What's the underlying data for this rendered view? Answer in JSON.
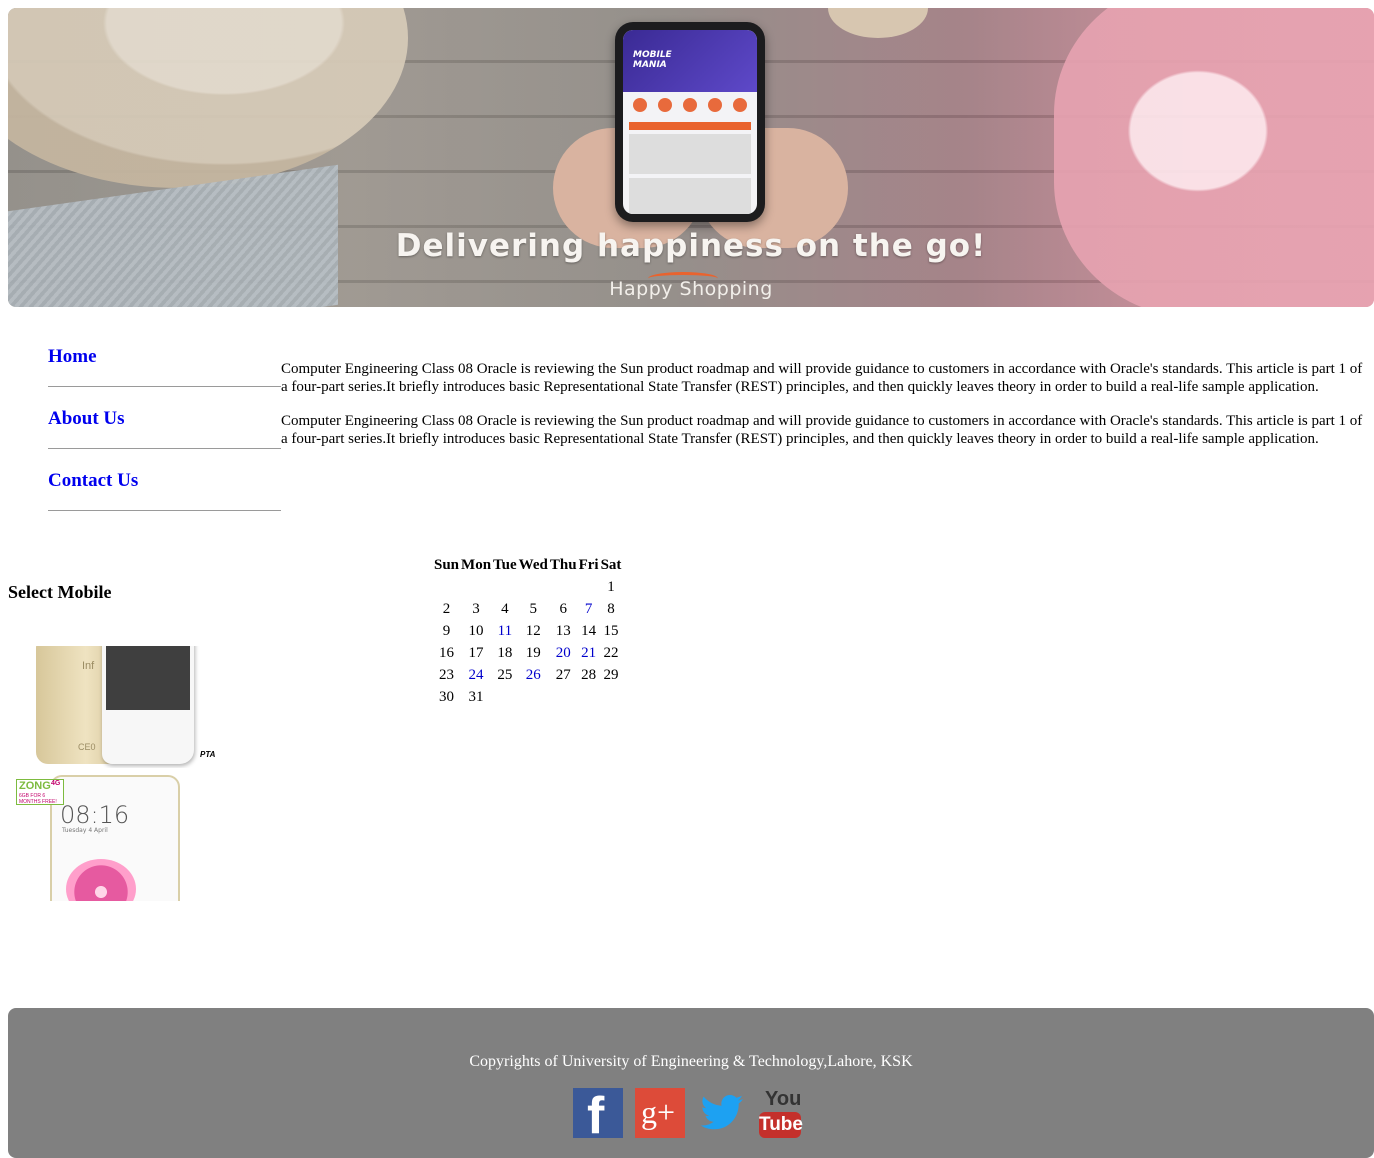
{
  "banner": {
    "headline": "Delivering happiness on the go!",
    "subline": "Happy Shopping",
    "phone_screen_title": "MOBILE MANIA"
  },
  "nav": {
    "items": [
      {
        "label": "Home"
      },
      {
        "label": "About Us"
      },
      {
        "label": "Contact Us"
      }
    ],
    "link_color": "#0000ee"
  },
  "article": {
    "paragraphs": [
      "Computer Engineering Class 08 Oracle is reviewing the Sun product roadmap and will provide guidance to customers in accordance with Oracle's standards. This article is part 1 of a four-part series.It briefly introduces basic Representational State Transfer (REST) principles, and then quickly leaves theory in order to build a real-life sample application.",
      "Computer Engineering Class 08 Oracle is reviewing the Sun product roadmap and will provide guidance to customers in accordance with Oracle's standards. This article is part 1 of a four-part series.It briefly introduces basic Representational State Transfer (REST) principles, and then quickly leaves theory in order to build a real-life sample application."
    ]
  },
  "select_mobile": {
    "heading": "Select Mobile",
    "mobiles": [
      {
        "brand_text": "Inf",
        "cert_text": "CE0",
        "badge": "PTA"
      },
      {
        "carrier_text": "ZONG",
        "carrier_badge": "4G",
        "offer_text": "6GB FOR 6 MONTHS FREE!",
        "lock_time": "08:16",
        "lock_date": "Tuesday 4 April"
      }
    ]
  },
  "calendar": {
    "weekdays": [
      "Sun",
      "Mon",
      "Tue",
      "Wed",
      "Thu",
      "Fri",
      "Sat"
    ],
    "weeks": [
      [
        "",
        "",
        "",
        "",
        "",
        "",
        "1"
      ],
      [
        "2",
        "3",
        "4",
        "5",
        "6",
        "7",
        "8"
      ],
      [
        "9",
        "10",
        "11",
        "12",
        "13",
        "14",
        "15"
      ],
      [
        "16",
        "17",
        "18",
        "19",
        "20",
        "21",
        "22"
      ],
      [
        "23",
        "24",
        "25",
        "26",
        "27",
        "28",
        "29"
      ],
      [
        "30",
        "31",
        "",
        "",
        "",
        "",
        ""
      ]
    ],
    "highlighted_days": [
      "7",
      "11",
      "20",
      "21",
      "24",
      "26"
    ],
    "highlight_color": "#0000cc"
  },
  "footer": {
    "copyright": "Copyrights of University of Engineering & Technology,Lahore, KSK",
    "background": "#808080",
    "social_icons": [
      {
        "name": "facebook-icon",
        "glyph": "f"
      },
      {
        "name": "google-plus-icon",
        "glyph": "g+"
      },
      {
        "name": "twitter-icon"
      },
      {
        "name": "youtube-icon",
        "text_top": "You",
        "text_bottom": "Tube"
      }
    ]
  }
}
